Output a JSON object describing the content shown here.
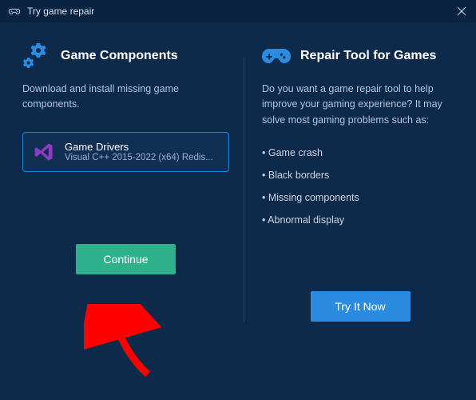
{
  "titlebar": {
    "title": "Try game repair"
  },
  "left": {
    "title": "Game Components",
    "desc": "Download and install missing game components.",
    "driver": {
      "name": "Game Drivers",
      "sub": "Visual C++ 2015-2022 (x64) Redis..."
    },
    "continue_label": "Continue"
  },
  "right": {
    "title": "Repair Tool for Games",
    "desc": "Do you want a game repair tool to help improve your gaming experience? It may solve most gaming problems such as:",
    "bullets": [
      "Game crash",
      "Black borders",
      "Missing components",
      "Abnormal display"
    ],
    "try_label": "Try It Now"
  }
}
